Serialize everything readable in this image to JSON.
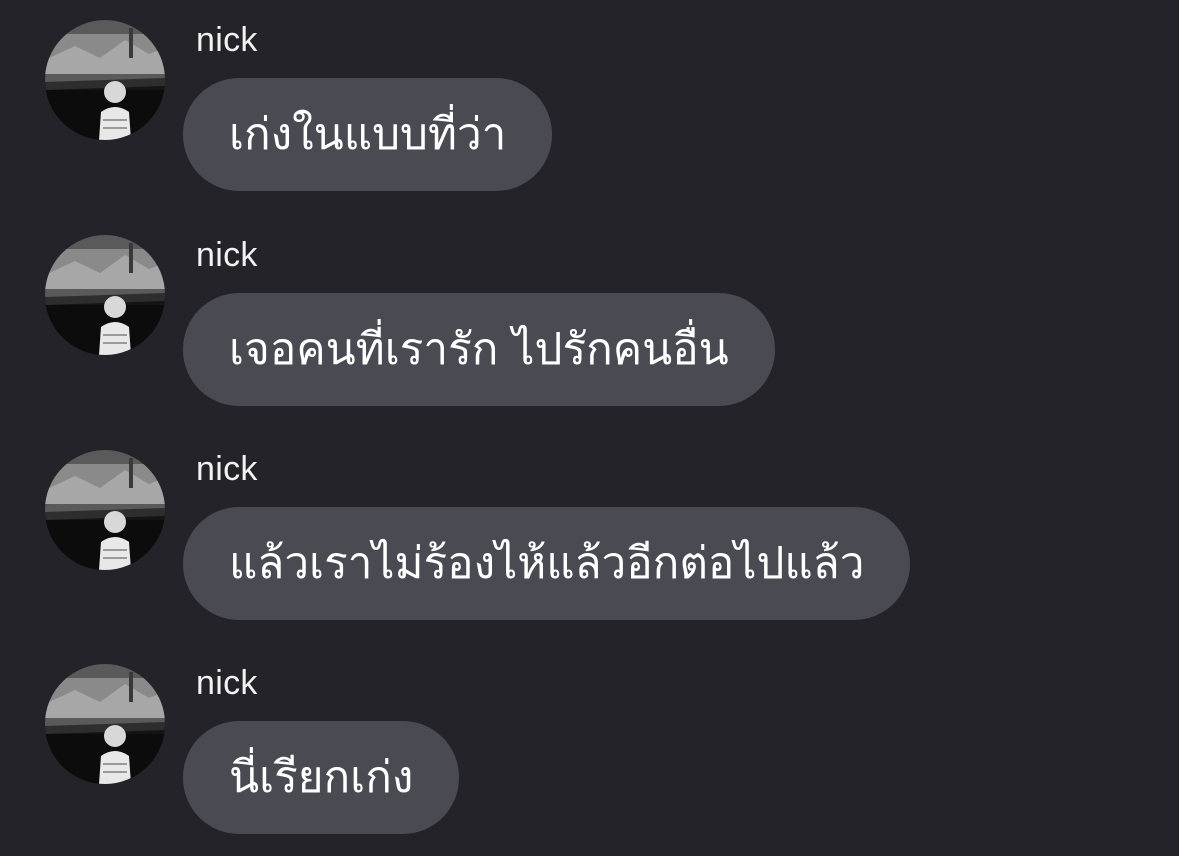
{
  "colors": {
    "background": "#232329",
    "bubble": "#4a4a52",
    "text": "#ffffff"
  },
  "messages": [
    {
      "sender": "nick",
      "text": "เก่งในแบบที่ว่า",
      "avatar": "profile-photo"
    },
    {
      "sender": "nick",
      "text": "เจอคนที่เรารัก ไปรักคนอื่น",
      "avatar": "profile-photo"
    },
    {
      "sender": "nick",
      "text": "แล้วเราไม่ร้องไห้แล้วอีกต่อไปแล้ว",
      "avatar": "profile-photo"
    },
    {
      "sender": "nick",
      "text": "นี่เรียกเก่ง",
      "avatar": "profile-photo"
    }
  ]
}
